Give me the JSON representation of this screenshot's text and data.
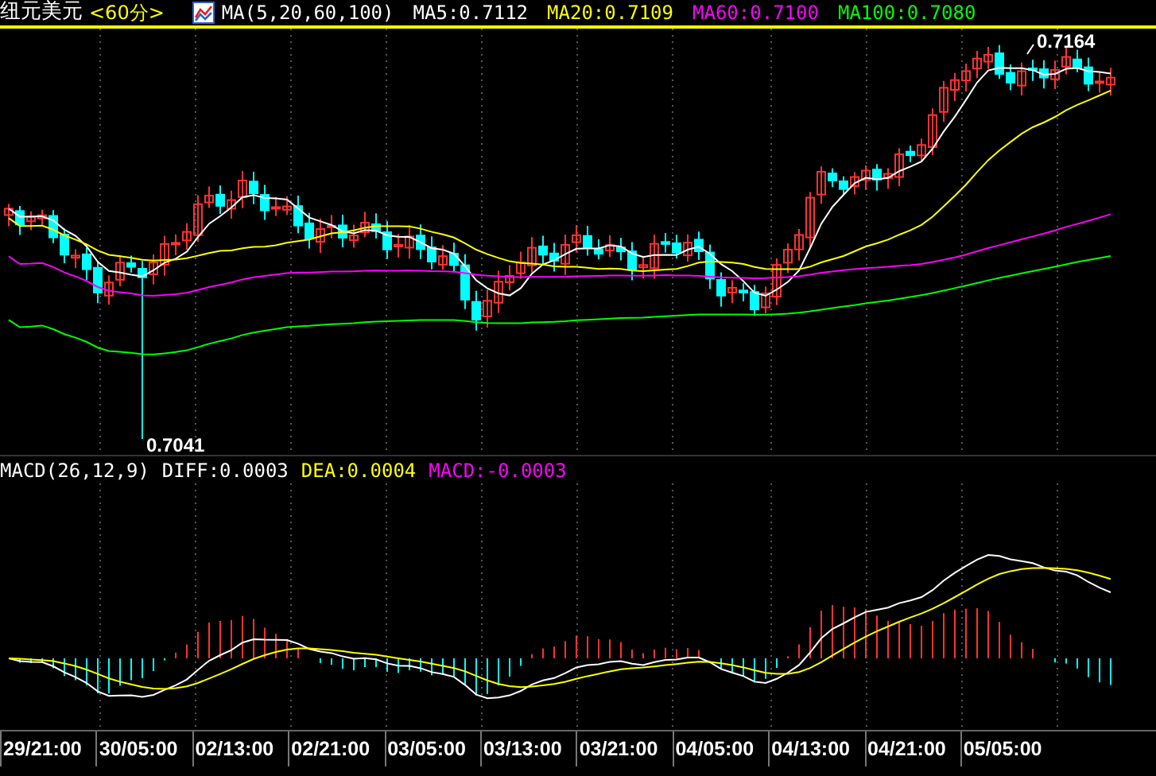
{
  "header": {
    "symbol": "纽元美元",
    "period": "<60分>",
    "indicator": "MA(5,20,60,100)",
    "ma_values": [
      {
        "label": "MA5:0.7112",
        "color": "#ffffff"
      },
      {
        "label": "MA20:0.7109",
        "color": "#ffff00"
      },
      {
        "label": "MA60:0.7100",
        "color": "#ff00ff"
      },
      {
        "label": "MA100:0.7080",
        "color": "#00ff00"
      }
    ]
  },
  "price_pane": {
    "high_label": "0.7164",
    "low_label": "0.7041"
  },
  "macd_header": {
    "indicator": "MACD(26,12,9)",
    "values": [
      {
        "label": "DIFF:0.0003",
        "color": "#ffffff"
      },
      {
        "label": "DEA:0.0004",
        "color": "#ffff00"
      },
      {
        "label": "MACD:-0.0003",
        "color": "#ff00ff"
      }
    ]
  },
  "time_axis": [
    "29/21:00",
    "30/05:00",
    "02/13:00",
    "02/21:00",
    "03/05:00",
    "03/13:00",
    "03/21:00",
    "04/05:00",
    "04/13:00",
    "04/21:00",
    "05/05:00"
  ]
}
